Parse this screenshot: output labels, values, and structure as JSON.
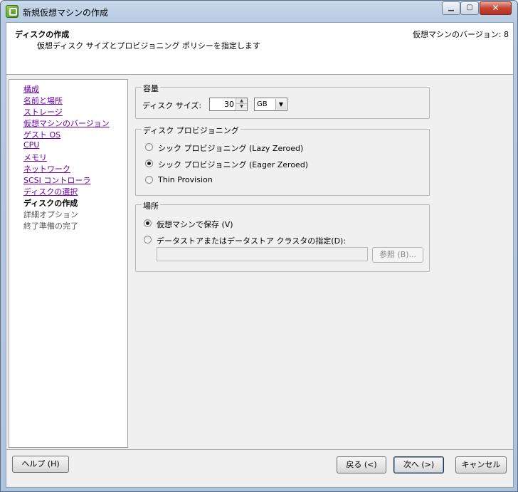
{
  "window": {
    "title": "新規仮想マシンの作成",
    "controls": {
      "minimize": "▁",
      "maximize": "▢",
      "close": "✕"
    }
  },
  "header": {
    "title": "ディスクの作成",
    "subtitle": "仮想ディスク サイズとプロビジョニング ポリシーを指定します",
    "version": "仮想マシンのバージョン: 8"
  },
  "nav": {
    "items": [
      {
        "label": "構成",
        "state": "link"
      },
      {
        "label": "名前と場所",
        "state": "link"
      },
      {
        "label": "ストレージ",
        "state": "link"
      },
      {
        "label": "仮想マシンのバージョン",
        "state": "link"
      },
      {
        "label": "ゲスト OS",
        "state": "link"
      },
      {
        "label": "CPU",
        "state": "link"
      },
      {
        "label": "メモリ",
        "state": "link"
      },
      {
        "label": "ネットワーク",
        "state": "link"
      },
      {
        "label": "SCSI コントローラ",
        "state": "link"
      },
      {
        "label": "ディスクの選択",
        "state": "link"
      },
      {
        "label": "ディスクの作成",
        "state": "active"
      },
      {
        "label": "詳細オプション",
        "state": "inactive"
      },
      {
        "label": "終了準備の完了",
        "state": "inactive"
      }
    ]
  },
  "capacity": {
    "group_label": "容量",
    "disk_size_label": "ディスク サイズ:",
    "disk_size_value": "30",
    "unit": "GB"
  },
  "provisioning": {
    "group_label": "ディスク プロビジョニング",
    "options": [
      {
        "label": "シック プロビジョニング (Lazy Zeroed)",
        "checked": false
      },
      {
        "label": "シック プロビジョニング (Eager Zeroed)",
        "checked": true
      },
      {
        "label": "Thin Provision",
        "checked": false
      }
    ]
  },
  "location": {
    "group_label": "場所",
    "options": [
      {
        "label": "仮想マシンで保存 (V)",
        "checked": true
      },
      {
        "label": "データストアまたはデータストア クラスタの指定(D):",
        "checked": false
      }
    ],
    "path_value": "",
    "browse_label": "参照 (B)..."
  },
  "footer": {
    "help": "ヘルプ (H)",
    "back": "戻る (<)",
    "next": "次へ (>)",
    "cancel": "キャンセル"
  }
}
